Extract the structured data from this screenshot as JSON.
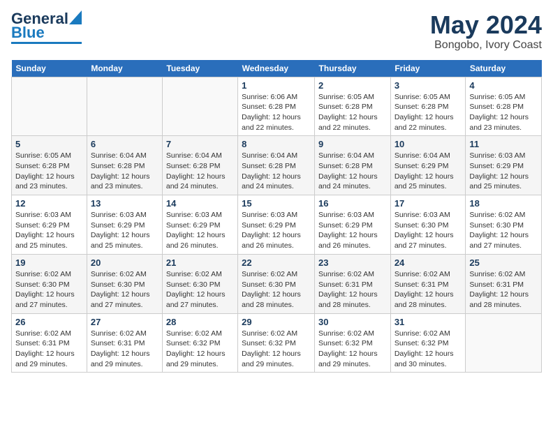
{
  "header": {
    "logo_general": "General",
    "logo_blue": "Blue",
    "title": "May 2024",
    "subtitle": "Bongobo, Ivory Coast"
  },
  "weekdays": [
    "Sunday",
    "Monday",
    "Tuesday",
    "Wednesday",
    "Thursday",
    "Friday",
    "Saturday"
  ],
  "weeks": [
    [
      {
        "day": "",
        "sunrise": "",
        "sunset": "",
        "daylight": ""
      },
      {
        "day": "",
        "sunrise": "",
        "sunset": "",
        "daylight": ""
      },
      {
        "day": "",
        "sunrise": "",
        "sunset": "",
        "daylight": ""
      },
      {
        "day": "1",
        "sunrise": "Sunrise: 6:06 AM",
        "sunset": "Sunset: 6:28 PM",
        "daylight": "Daylight: 12 hours and 22 minutes."
      },
      {
        "day": "2",
        "sunrise": "Sunrise: 6:05 AM",
        "sunset": "Sunset: 6:28 PM",
        "daylight": "Daylight: 12 hours and 22 minutes."
      },
      {
        "day": "3",
        "sunrise": "Sunrise: 6:05 AM",
        "sunset": "Sunset: 6:28 PM",
        "daylight": "Daylight: 12 hours and 22 minutes."
      },
      {
        "day": "4",
        "sunrise": "Sunrise: 6:05 AM",
        "sunset": "Sunset: 6:28 PM",
        "daylight": "Daylight: 12 hours and 23 minutes."
      }
    ],
    [
      {
        "day": "5",
        "sunrise": "Sunrise: 6:05 AM",
        "sunset": "Sunset: 6:28 PM",
        "daylight": "Daylight: 12 hours and 23 minutes."
      },
      {
        "day": "6",
        "sunrise": "Sunrise: 6:04 AM",
        "sunset": "Sunset: 6:28 PM",
        "daylight": "Daylight: 12 hours and 23 minutes."
      },
      {
        "day": "7",
        "sunrise": "Sunrise: 6:04 AM",
        "sunset": "Sunset: 6:28 PM",
        "daylight": "Daylight: 12 hours and 24 minutes."
      },
      {
        "day": "8",
        "sunrise": "Sunrise: 6:04 AM",
        "sunset": "Sunset: 6:28 PM",
        "daylight": "Daylight: 12 hours and 24 minutes."
      },
      {
        "day": "9",
        "sunrise": "Sunrise: 6:04 AM",
        "sunset": "Sunset: 6:28 PM",
        "daylight": "Daylight: 12 hours and 24 minutes."
      },
      {
        "day": "10",
        "sunrise": "Sunrise: 6:04 AM",
        "sunset": "Sunset: 6:29 PM",
        "daylight": "Daylight: 12 hours and 25 minutes."
      },
      {
        "day": "11",
        "sunrise": "Sunrise: 6:03 AM",
        "sunset": "Sunset: 6:29 PM",
        "daylight": "Daylight: 12 hours and 25 minutes."
      }
    ],
    [
      {
        "day": "12",
        "sunrise": "Sunrise: 6:03 AM",
        "sunset": "Sunset: 6:29 PM",
        "daylight": "Daylight: 12 hours and 25 minutes."
      },
      {
        "day": "13",
        "sunrise": "Sunrise: 6:03 AM",
        "sunset": "Sunset: 6:29 PM",
        "daylight": "Daylight: 12 hours and 25 minutes."
      },
      {
        "day": "14",
        "sunrise": "Sunrise: 6:03 AM",
        "sunset": "Sunset: 6:29 PM",
        "daylight": "Daylight: 12 hours and 26 minutes."
      },
      {
        "day": "15",
        "sunrise": "Sunrise: 6:03 AM",
        "sunset": "Sunset: 6:29 PM",
        "daylight": "Daylight: 12 hours and 26 minutes."
      },
      {
        "day": "16",
        "sunrise": "Sunrise: 6:03 AM",
        "sunset": "Sunset: 6:29 PM",
        "daylight": "Daylight: 12 hours and 26 minutes."
      },
      {
        "day": "17",
        "sunrise": "Sunrise: 6:03 AM",
        "sunset": "Sunset: 6:30 PM",
        "daylight": "Daylight: 12 hours and 27 minutes."
      },
      {
        "day": "18",
        "sunrise": "Sunrise: 6:02 AM",
        "sunset": "Sunset: 6:30 PM",
        "daylight": "Daylight: 12 hours and 27 minutes."
      }
    ],
    [
      {
        "day": "19",
        "sunrise": "Sunrise: 6:02 AM",
        "sunset": "Sunset: 6:30 PM",
        "daylight": "Daylight: 12 hours and 27 minutes."
      },
      {
        "day": "20",
        "sunrise": "Sunrise: 6:02 AM",
        "sunset": "Sunset: 6:30 PM",
        "daylight": "Daylight: 12 hours and 27 minutes."
      },
      {
        "day": "21",
        "sunrise": "Sunrise: 6:02 AM",
        "sunset": "Sunset: 6:30 PM",
        "daylight": "Daylight: 12 hours and 27 minutes."
      },
      {
        "day": "22",
        "sunrise": "Sunrise: 6:02 AM",
        "sunset": "Sunset: 6:30 PM",
        "daylight": "Daylight: 12 hours and 28 minutes."
      },
      {
        "day": "23",
        "sunrise": "Sunrise: 6:02 AM",
        "sunset": "Sunset: 6:31 PM",
        "daylight": "Daylight: 12 hours and 28 minutes."
      },
      {
        "day": "24",
        "sunrise": "Sunrise: 6:02 AM",
        "sunset": "Sunset: 6:31 PM",
        "daylight": "Daylight: 12 hours and 28 minutes."
      },
      {
        "day": "25",
        "sunrise": "Sunrise: 6:02 AM",
        "sunset": "Sunset: 6:31 PM",
        "daylight": "Daylight: 12 hours and 28 minutes."
      }
    ],
    [
      {
        "day": "26",
        "sunrise": "Sunrise: 6:02 AM",
        "sunset": "Sunset: 6:31 PM",
        "daylight": "Daylight: 12 hours and 29 minutes."
      },
      {
        "day": "27",
        "sunrise": "Sunrise: 6:02 AM",
        "sunset": "Sunset: 6:31 PM",
        "daylight": "Daylight: 12 hours and 29 minutes."
      },
      {
        "day": "28",
        "sunrise": "Sunrise: 6:02 AM",
        "sunset": "Sunset: 6:32 PM",
        "daylight": "Daylight: 12 hours and 29 minutes."
      },
      {
        "day": "29",
        "sunrise": "Sunrise: 6:02 AM",
        "sunset": "Sunset: 6:32 PM",
        "daylight": "Daylight: 12 hours and 29 minutes."
      },
      {
        "day": "30",
        "sunrise": "Sunrise: 6:02 AM",
        "sunset": "Sunset: 6:32 PM",
        "daylight": "Daylight: 12 hours and 29 minutes."
      },
      {
        "day": "31",
        "sunrise": "Sunrise: 6:02 AM",
        "sunset": "Sunset: 6:32 PM",
        "daylight": "Daylight: 12 hours and 30 minutes."
      },
      {
        "day": "",
        "sunrise": "",
        "sunset": "",
        "daylight": ""
      }
    ]
  ]
}
